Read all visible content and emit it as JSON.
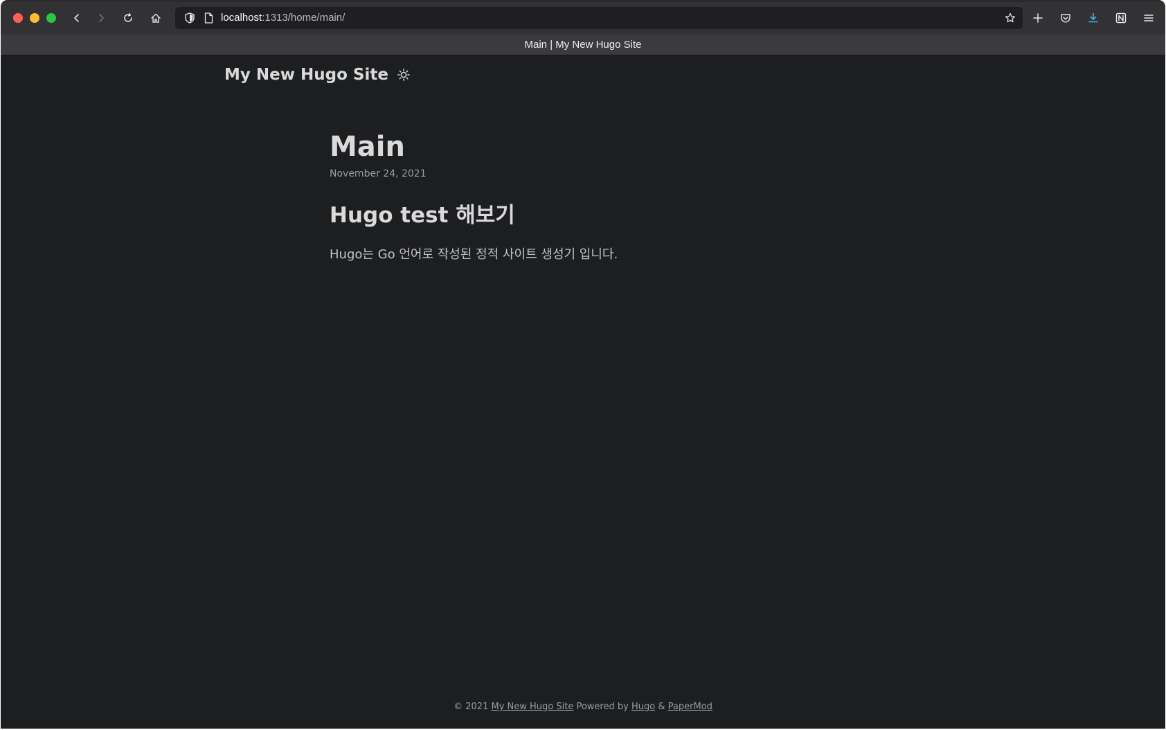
{
  "browser": {
    "url_host": "localhost",
    "url_path": ":1313/home/main/",
    "tab_title": "Main | My New Hugo Site"
  },
  "site": {
    "title": "My New Hugo Site",
    "theme_toggle_icon": "sun-icon"
  },
  "post": {
    "title": "Main",
    "date": "November 24, 2021",
    "heading": "Hugo test 해보기",
    "paragraph": "Hugo는 Go 언어로 작성된 정적 사이트 생성기 입니다."
  },
  "footer": {
    "copyright": "© 2021",
    "site_link": "My New Hugo Site",
    "powered_by": "Powered by",
    "hugo_link": "Hugo",
    "amp": "&",
    "papermod_link": "PaperMod"
  },
  "colors": {
    "page_background": "#1d1e20",
    "toolbar_background": "#323234",
    "primary_text": "#dadadb",
    "secondary_text": "#9b9c9d",
    "download_accent": "#3fb7f2"
  }
}
